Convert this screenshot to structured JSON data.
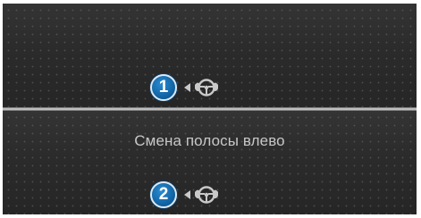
{
  "screen": {
    "top_panel": {
      "callout_number": "1",
      "arrow_icon": "left-arrow-icon",
      "wheel_icon": "steering-wheel-hands-icon"
    },
    "bottom_panel": {
      "message": "Смена полосы влево",
      "callout_number": "2",
      "arrow_icon": "left-arrow-icon",
      "wheel_icon": "steering-wheel-hands-icon"
    }
  },
  "colors": {
    "background": "#2d2d2d",
    "divider": "#dcdcdc",
    "text": "#c7c7c7",
    "callout_fill": "#0e5f9e",
    "icon": "#c9c9c9"
  }
}
